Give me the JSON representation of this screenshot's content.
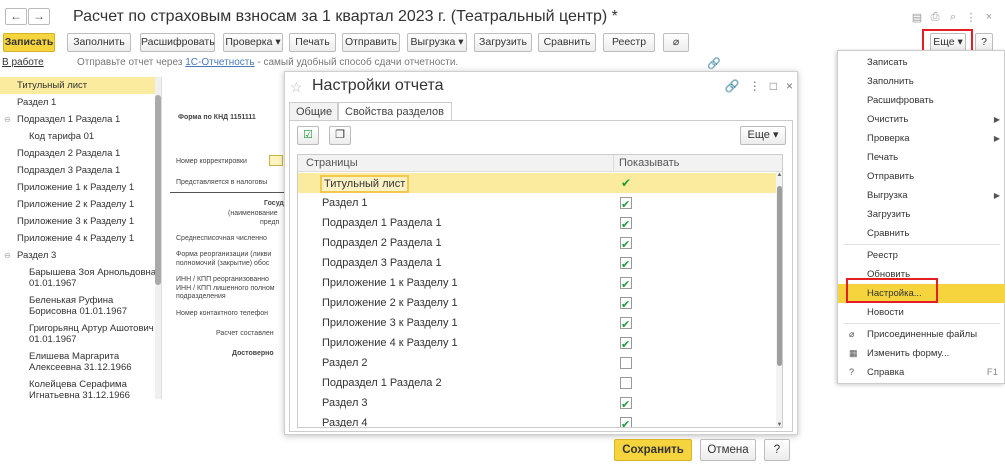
{
  "window": {
    "title": "Расчет по страховым взносам за 1 квартал 2023 г. (Театральный центр) *",
    "back_icon": "←",
    "forward_icon": "→"
  },
  "toolbar": {
    "save": "Записать",
    "fill": "Заполнить",
    "decode": "Расшифровать",
    "check": "Проверка",
    "print": "Печать",
    "send": "Отправить",
    "export": "Выгрузка",
    "load": "Загрузить",
    "compare": "Сравнить",
    "registry": "Реестр",
    "more": "Еще",
    "help": "?"
  },
  "info": {
    "status": "В работе",
    "text_before": "Отправьте отчет через",
    "link": "1С-Отчетность",
    "text_after": "- самый удобный способ сдачи отчетности."
  },
  "tree": {
    "items": [
      {
        "label": "Титульный лист",
        "selected": true
      },
      {
        "label": "Раздел 1"
      },
      {
        "label": "Подраздел 1 Раздела 1",
        "mark": "⊖"
      },
      {
        "label": "Код тарифа 01",
        "indent": 2
      },
      {
        "label": "Подраздел 2 Раздела 1"
      },
      {
        "label": "Подраздел 3 Раздела 1"
      },
      {
        "label": "Приложение 1 к Разделу 1"
      },
      {
        "label": "Приложение 2 к Разделу 1"
      },
      {
        "label": "Приложение 3 к Разделу 1"
      },
      {
        "label": "Приложение 4 к Разделу 1"
      },
      {
        "label": "Раздел 3",
        "mark": "⊖"
      }
    ],
    "persons": [
      {
        "name": "Барышева Зоя Арнольдовна",
        "date": "01.01.1967"
      },
      {
        "name": "Беленькая Руфина",
        "date": "Борисовна 01.01.1967"
      },
      {
        "name": "Григорьянц Артур Ашотович",
        "date": "01.01.1967"
      },
      {
        "name": "Елишева Маргарита",
        "date": "Алексеевна 31.12.1966"
      },
      {
        "name": "Колейцева Серафима",
        "date": "Игнатьевна 31.12.1966"
      }
    ]
  },
  "form": {
    "knd": "Форма по КНД 1151111",
    "correction": "Номер корректировки",
    "submitted": "Представляется в налоговы",
    "gov": "Государ",
    "name_note": "(наименование",
    "pred": "предп",
    "avg": "Среднесписочная численно",
    "reorg1": "Форма реорганизации (ликви",
    "reorg2": "полномочий (закрытие) обос",
    "inn1": "ИНН / КПП реорганизованно",
    "inn2": "ИНН / КПП лишенного полном",
    "inn3": "подразделения",
    "phone": "Номер контактного телефон",
    "calc": "Расчет составлен",
    "reliability": "Достоверно"
  },
  "dialog": {
    "title": "Настройки отчета",
    "tabs": [
      "Общие",
      "Свойства разделов"
    ],
    "more": "Еще",
    "col_pages": "Страницы",
    "col_show": "Показывать",
    "rows": [
      {
        "name": "Титульный лист",
        "show": true,
        "locked": true
      },
      {
        "name": "Раздел 1",
        "show": true
      },
      {
        "name": "Подраздел 1 Раздела 1",
        "show": true
      },
      {
        "name": "Подраздел 2 Раздела 1",
        "show": true
      },
      {
        "name": "Подраздел 3 Раздела 1",
        "show": true
      },
      {
        "name": "Приложение 1 к Разделу 1",
        "show": true
      },
      {
        "name": "Приложение 2 к Разделу 1",
        "show": true
      },
      {
        "name": "Приложение 3 к Разделу 1",
        "show": true
      },
      {
        "name": "Приложение 4 к Разделу 1",
        "show": true
      },
      {
        "name": "Раздел 2",
        "show": false
      },
      {
        "name": "Подраздел 1 Раздела 2",
        "show": false
      },
      {
        "name": "Раздел 3",
        "show": true
      },
      {
        "name": "Раздел 4",
        "show": true
      }
    ],
    "save": "Сохранить",
    "cancel": "Отмена",
    "help": "?"
  },
  "menu": {
    "items": [
      {
        "label": "Записать"
      },
      {
        "label": "Заполнить"
      },
      {
        "label": "Расшифровать"
      },
      {
        "label": "Очистить",
        "arrow": true
      },
      {
        "label": "Проверка",
        "arrow": true
      },
      {
        "label": "Печать"
      },
      {
        "label": "Отправить"
      },
      {
        "label": "Выгрузка",
        "arrow": true
      },
      {
        "label": "Загрузить"
      },
      {
        "label": "Сравнить"
      },
      {
        "label": "Реестр"
      },
      {
        "label": "Обновить"
      },
      {
        "label": "Настройка...",
        "highlighted": true
      },
      {
        "label": "Новости"
      },
      {
        "label": "Присоединенные файлы",
        "icon": "paperclip-icon"
      },
      {
        "label": "Изменить форму...",
        "icon": "form-icon"
      },
      {
        "label": "Справка",
        "icon": "help-icon",
        "key": "F1"
      }
    ]
  },
  "colors": {
    "accent": "#f5d43e",
    "highlight_row": "#fbeb9e",
    "red_frame": "#e31e24",
    "check": "#1d9a3a",
    "link": "#4a79b5"
  }
}
